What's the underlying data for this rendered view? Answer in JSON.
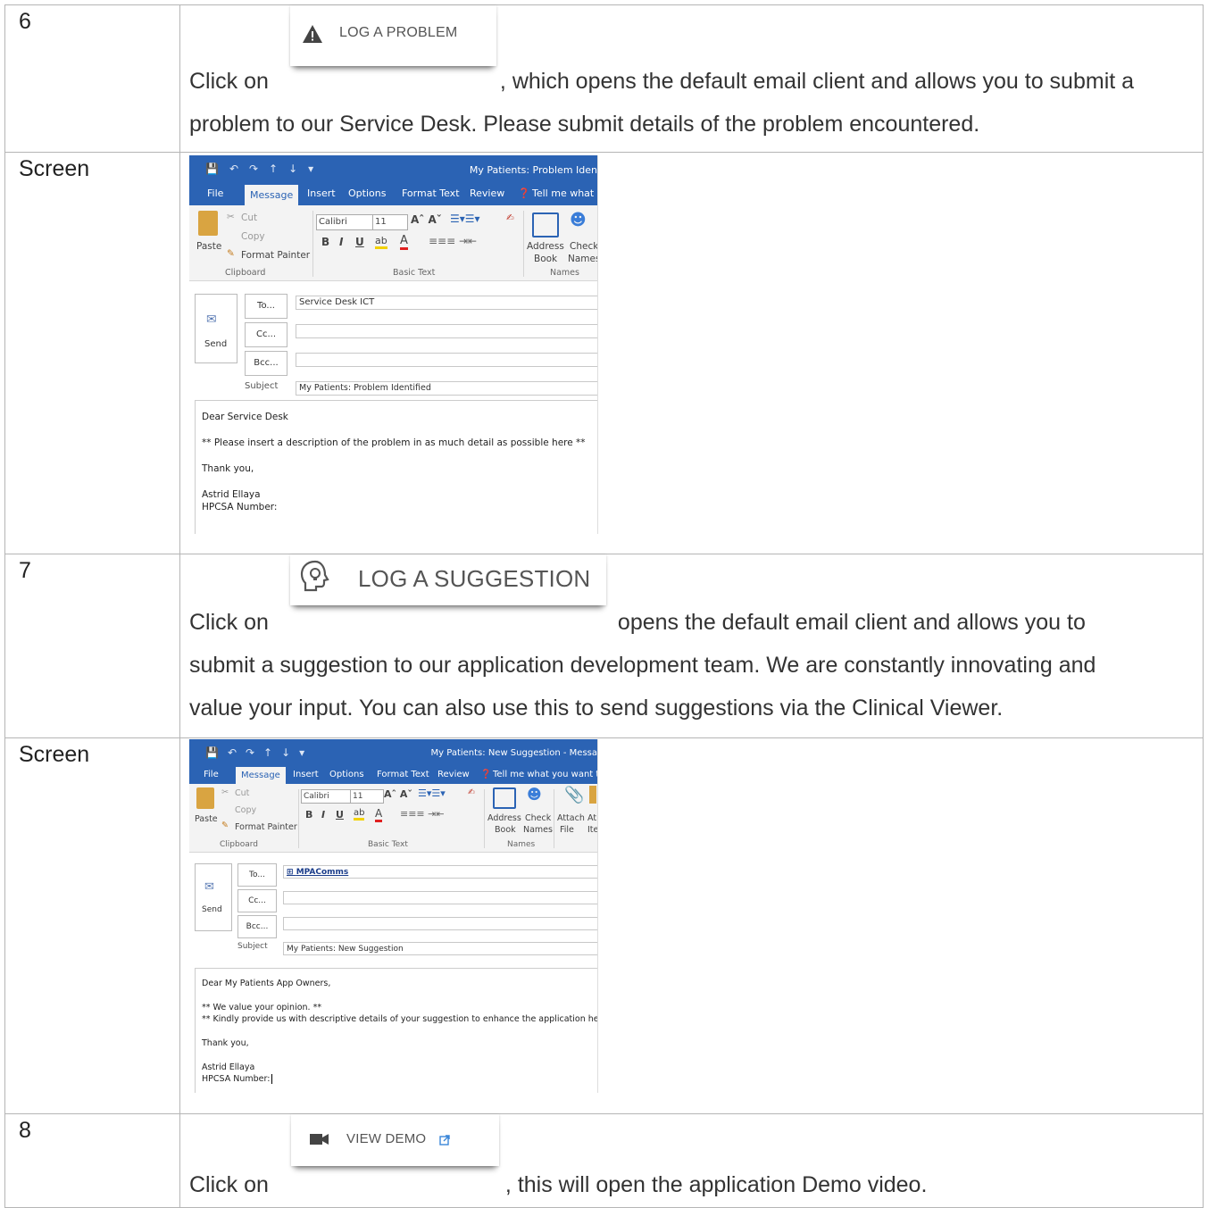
{
  "rows": [
    {
      "num": "6",
      "text_before": "Click on",
      "button_label": "LOG A PROBLEM",
      "text_after_1": ", which opens the default email client and allows you to submit a",
      "text_after_2": "problem to our Service Desk. Please submit details of the problem encountered."
    },
    {
      "num": "Screen",
      "mail": {
        "title": "My Patients: Problem Iden",
        "tabs": [
          "File",
          "Message",
          "Insert",
          "Options",
          "Format Text",
          "Review",
          "Tell me what y"
        ],
        "clipboard": {
          "cut": "Cut",
          "copy": "Copy",
          "paste": "Paste",
          "painter": "Format Painter",
          "group": "Clipboard"
        },
        "font": {
          "name": "Calibri",
          "size": "11",
          "group": "Basic Text"
        },
        "names": {
          "address": "Address",
          "book": "Book",
          "check": "Check",
          "names": "Names",
          "group": "Names"
        },
        "send": "Send",
        "to_btn": "To...",
        "cc_btn": "Cc...",
        "bcc_btn": "Bcc...",
        "subject_label": "Subject",
        "to_value": "Service Desk ICT",
        "subject_value": "My Patients: Problem Identified",
        "body": [
          "Dear Service Desk",
          "** Please insert a description of the problem in as much detail as possible here **",
          "Thank you,",
          "Astrid Ellaya",
          "HPCSA Number:"
        ]
      }
    },
    {
      "num": "7",
      "text_before": "Click on",
      "button_label": "LOG A SUGGESTION",
      "text_after_1": "opens the default email client and allows you to",
      "text_after_2": "submit a suggestion to our application development team. We are constantly innovating and",
      "text_after_3": "value your input. You can also use this to send suggestions via the Clinical Viewer."
    },
    {
      "num": "Screen",
      "mail": {
        "title": "My Patients: New Suggestion - Messa",
        "tabs": [
          "File",
          "Message",
          "Insert",
          "Options",
          "Format Text",
          "Review",
          "Tell me what you want to"
        ],
        "clipboard": {
          "cut": "Cut",
          "copy": "Copy",
          "paste": "Paste",
          "painter": "Format Painter",
          "group": "Clipboard"
        },
        "font": {
          "name": "Calibri",
          "size": "11",
          "group": "Basic Text"
        },
        "names": {
          "address": "Address",
          "book": "Book",
          "check": "Check",
          "names": "Names",
          "group": "Names",
          "attach": "Attach",
          "file": "File",
          "at": "At",
          "ite": "Ite"
        },
        "send": "Send",
        "to_btn": "To...",
        "cc_btn": "Cc...",
        "bcc_btn": "Bcc...",
        "subject_label": "Subject",
        "to_value": "MPAComms",
        "subject_value": "My Patients: New Suggestion",
        "body": [
          "Dear My Patients App Owners,",
          "** We value your opinion. **",
          "** Kindly provide us with descriptive details of your suggestion to enhance the application here... **",
          "Thank you,",
          "Astrid Ellaya",
          "HPCSA Number:"
        ]
      }
    },
    {
      "num": "8",
      "text_before": "Click on",
      "button_label": "VIEW DEMO",
      "text_after_1": ", this will open the application Demo video."
    }
  ]
}
